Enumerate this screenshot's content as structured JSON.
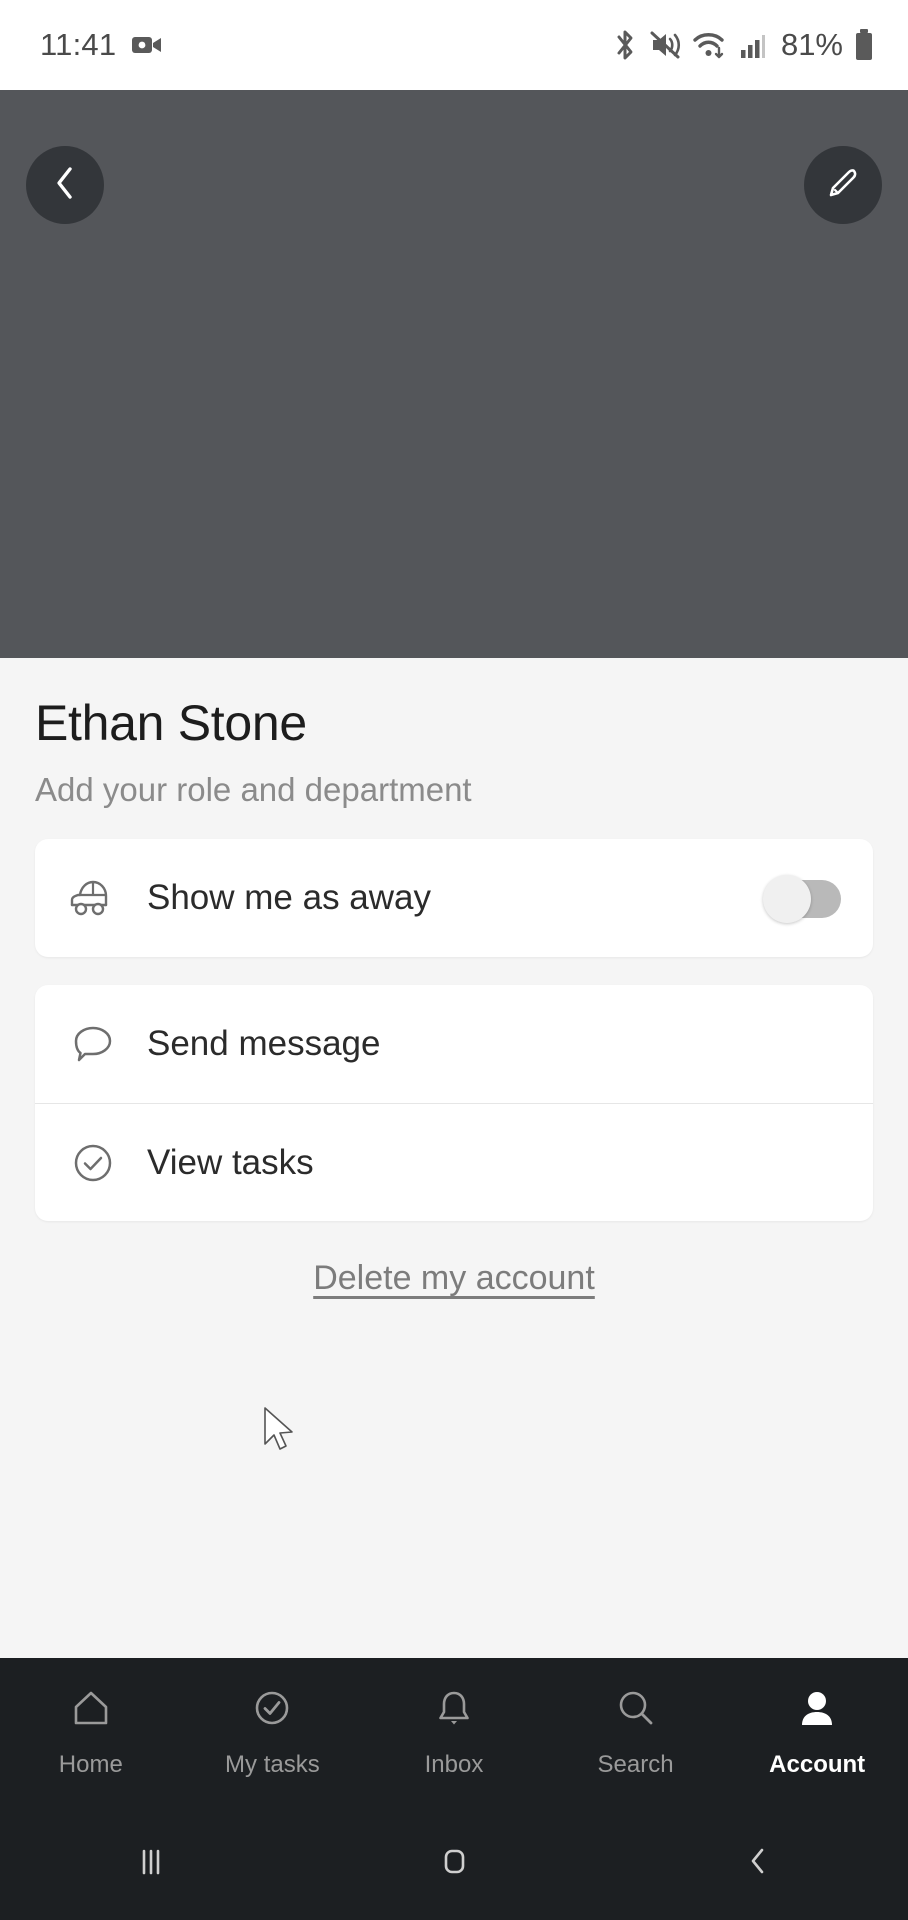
{
  "status_bar": {
    "time": "11:41",
    "battery_text": "81%",
    "icons": [
      "video-recording-icon",
      "bluetooth-icon",
      "mute-vibrate-icon",
      "wifi-icon",
      "cellular-signal-icon",
      "battery-icon"
    ]
  },
  "hero": {
    "background_color": "#54565a",
    "back_button": "back-chevron-icon",
    "edit_button": "pencil-icon"
  },
  "profile": {
    "name": "Ethan Stone",
    "subtitle": "Add your role and department"
  },
  "away_card": {
    "icon": "car-icon",
    "label": "Show me as away",
    "toggle_state": "off"
  },
  "actions": [
    {
      "icon": "speech-bubble-icon",
      "label": "Send message"
    },
    {
      "icon": "check-circle-icon",
      "label": "View tasks"
    }
  ],
  "delete_link": {
    "label": "Delete my account"
  },
  "tabs": [
    {
      "label": "Home",
      "icon": "home-icon",
      "active": false
    },
    {
      "label": "My tasks",
      "icon": "check-circle-icon",
      "active": false
    },
    {
      "label": "Inbox",
      "icon": "bell-icon",
      "active": false
    },
    {
      "label": "Search",
      "icon": "magnifier-icon",
      "active": false
    },
    {
      "label": "Account",
      "icon": "person-icon",
      "active": true
    }
  ],
  "system_nav": {
    "recents": "recent-apps-icon",
    "home": "home-square-icon",
    "back": "back-chevron-icon"
  },
  "colors": {
    "hero_bg": "#54565a",
    "sheet_bg": "#f5f5f5",
    "card_bg": "#ffffff",
    "navbar_bg": "#1c1f22",
    "accent_text": "#ffffff"
  }
}
